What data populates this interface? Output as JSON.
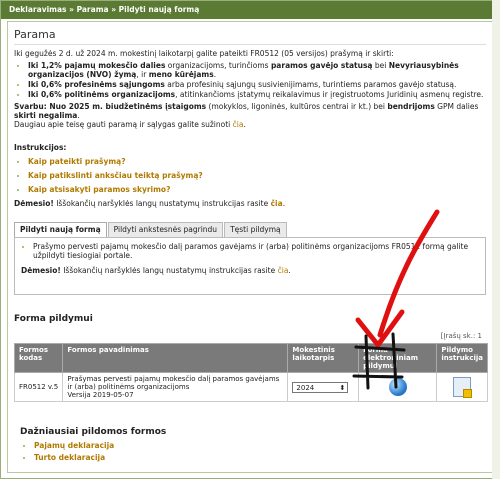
{
  "breadcrumb": {
    "part1": "Deklaravimas",
    "sep": " » ",
    "part2": "Parama",
    "part3": "Pildyti naują formą"
  },
  "page_title": "Parama",
  "intro": "Iki gegužės 2 d. už 2024 m. mokestinį laikotarpį galite pateikti FR0512 (05 versijos) prašymą ir skirti:",
  "bullets": [
    {
      "pre": "Iki 1,2% pajamų mokesčio dalies",
      "mid": " organizacijoms, turinčioms ",
      "b2": "paramos gavėjo statusą",
      "mid2": " bei ",
      "b3": "Nevyriausybinės organizacijos (NVO) žymą",
      "mid3": ", ir ",
      "b4": "meno kūrėjams",
      "end": "."
    },
    {
      "pre": "Iki 0,6% profesinėms sąjungoms",
      "mid": " arba profesinių sąjungų susivienijimams, turintiems paramos gavėjo statusą."
    },
    {
      "pre": "Iki 0,6% politinėms organizacijoms",
      "mid": ", atitinkančioms įstatymų reikalavimus ir įregistruotoms Juridinių asmenų registre."
    }
  ],
  "note": {
    "pre": "Svarbu: Nuo 2025 m. biudžetinėms įstaigoms",
    "mid": " (mokyklos, ligoninės, kultūros centrai ir kt.) bei ",
    "b2": "bendrijoms",
    "mid2": " GPM dalies ",
    "b3": "skirti negalima",
    "end": "."
  },
  "more": {
    "text": "Daugiau apie teisę gauti paramą ir sąlygas galite sužinoti ",
    "link": "čia",
    "end": "."
  },
  "instructions": {
    "title": "Instrukcijos:",
    "links": [
      "Kaip pateikti prašymą?",
      "Kaip patikslinti anksčiau teiktą prašymą?",
      "Kaip atsisakyti paramos skyrimo?"
    ]
  },
  "attention": {
    "b": "Dėmesio!",
    "text": " Iššokančių naršyklės langų nustatymų instrukcijas rasite ",
    "link": "čia",
    "end": "."
  },
  "tabs": [
    "Pildyti naują formą",
    "Pildyti ankstesnės pagrindu",
    "Tęsti pildymą"
  ],
  "panel": {
    "bullet": "Prašymo pervesti pajamų mokesčio dalį paramos gavėjams ir (arba) politinėms organizacijoms FR0512 formą galite užpildyti tiesiogiai portale.",
    "attention_b": "Dėmesio!",
    "attention_text": " Iššokančių naršyklės langų nustatymų instrukcijas rasite ",
    "link": "čia",
    "end": "."
  },
  "forms": {
    "title": "Forma pildymui",
    "count": "[Įrašų sk.: 1",
    "headers": [
      "Formos kodas",
      "Formos pavadinimas",
      "Mokestinis laikotarpis",
      "Forma elektroniniam pildymui",
      "Pildymo instrukcija"
    ],
    "rows": [
      {
        "code": "FR0512 v.5",
        "name": "Prašymas pervesti pajamų mokesčio dalį paramos gavėjams ir (arba) politinėms organizacijoms",
        "version": "Versija 2019-05-07",
        "period": "2024"
      }
    ]
  },
  "frequent": {
    "title": "Dažniausiai pildomos formos",
    "links": [
      "Pajamų deklaracija",
      "Turto deklaracija"
    ]
  },
  "colors": {
    "header_green": "#5b7a33",
    "link_gold": "#b07a00",
    "annotation_red": "#e01010"
  }
}
